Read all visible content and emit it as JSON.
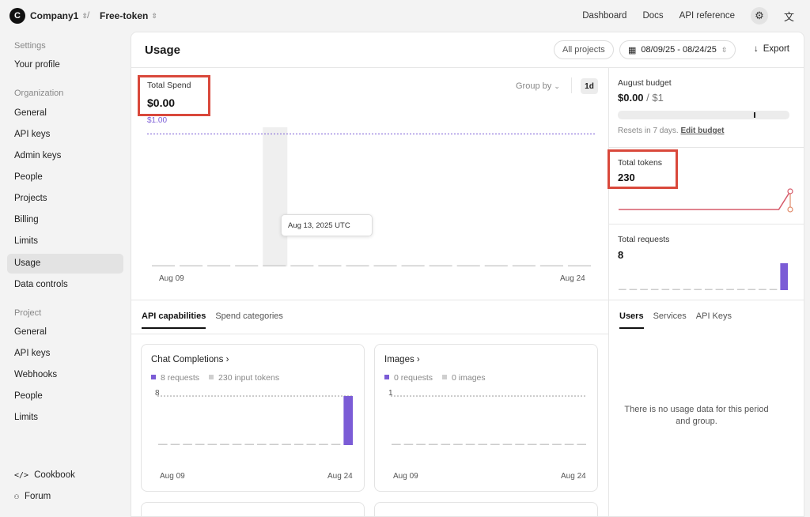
{
  "topbar": {
    "org_initial": "C",
    "org_name": "Company1",
    "project_name": "Free-token",
    "links": [
      "Dashboard",
      "Docs",
      "API reference"
    ],
    "gear_icon": "gear-icon",
    "translate_icon": "translate-icon"
  },
  "sidebar": {
    "settings_heading": "Settings",
    "your_profile": "Your profile",
    "organization_heading": "Organization",
    "org_items": [
      "General",
      "API keys",
      "Admin keys",
      "People",
      "Projects",
      "Billing",
      "Limits",
      "Usage",
      "Data controls"
    ],
    "active_item": "Usage",
    "project_heading": "Project",
    "project_items": [
      "General",
      "API keys",
      "Webhooks",
      "People",
      "Limits"
    ],
    "cookbook": "Cookbook",
    "forum": "Forum"
  },
  "header": {
    "title": "Usage",
    "projects_button": "All projects",
    "date_range": "08/09/25 - 08/24/25",
    "export_label": "Export"
  },
  "spend": {
    "label": "Total Spend",
    "value": "$0.00",
    "budget_line_label": "$1.00",
    "group_by": "Group by",
    "granularity": "1d",
    "tooltip": "Aug 13, 2025 UTC",
    "x_start": "Aug 09",
    "x_end": "Aug 24"
  },
  "budget": {
    "label": "August budget",
    "spent": "$0.00",
    "limit": "/ $1",
    "used_fraction": 0.0,
    "resets": "Resets in 7 days.",
    "edit_link": "Edit budget"
  },
  "tokens": {
    "label": "Total tokens",
    "value": "230"
  },
  "requests": {
    "label": "Total requests",
    "value": "8"
  },
  "capabilities": {
    "tabs": [
      "API capabilities",
      "Spend categories"
    ],
    "active_tab": "API capabilities",
    "chat": {
      "title": "Chat Completions",
      "legend_requests": "8 requests",
      "legend_tokens": "230 input tokens",
      "y_top": "8",
      "x_start": "Aug 09",
      "x_end": "Aug 24"
    },
    "images": {
      "title": "Images",
      "legend_requests": "0 requests",
      "legend_images": "0 images",
      "y_top": "1",
      "x_start": "Aug 09",
      "x_end": "Aug 24"
    }
  },
  "right_tabs": {
    "tabs": [
      "Users",
      "Services",
      "API Keys"
    ],
    "active_tab": "Users",
    "empty_message": "There is no usage data for this period and group."
  },
  "colors": {
    "accent": "#7b5cd6",
    "highlight": "#d9483b",
    "tokens_line": "#d65a6a"
  },
  "chart_data": [
    {
      "type": "bar",
      "title": "Total Spend",
      "categories": [
        "Aug 09",
        "Aug 10",
        "Aug 11",
        "Aug 12",
        "Aug 13",
        "Aug 14",
        "Aug 15",
        "Aug 16",
        "Aug 17",
        "Aug 18",
        "Aug 19",
        "Aug 20",
        "Aug 21",
        "Aug 22",
        "Aug 23",
        "Aug 24"
      ],
      "values": [
        0,
        0,
        0,
        0,
        0,
        0,
        0,
        0,
        0,
        0,
        0,
        0,
        0,
        0,
        0,
        0
      ],
      "budget_line": 1.0,
      "ylim": [
        0,
        1.05
      ],
      "hovered_category": "Aug 13"
    },
    {
      "type": "line",
      "title": "Total tokens",
      "categories": [
        "Aug 09",
        "Aug 10",
        "Aug 11",
        "Aug 12",
        "Aug 13",
        "Aug 14",
        "Aug 15",
        "Aug 16",
        "Aug 17",
        "Aug 18",
        "Aug 19",
        "Aug 20",
        "Aug 21",
        "Aug 22",
        "Aug 23",
        "Aug 24"
      ],
      "values": [
        0,
        0,
        0,
        0,
        0,
        0,
        0,
        0,
        0,
        0,
        0,
        0,
        0,
        0,
        0,
        230
      ],
      "ylim": [
        0,
        230
      ]
    },
    {
      "type": "bar",
      "title": "Total requests",
      "categories": [
        "Aug 09",
        "Aug 10",
        "Aug 11",
        "Aug 12",
        "Aug 13",
        "Aug 14",
        "Aug 15",
        "Aug 16",
        "Aug 17",
        "Aug 18",
        "Aug 19",
        "Aug 20",
        "Aug 21",
        "Aug 22",
        "Aug 23",
        "Aug 24"
      ],
      "values": [
        0,
        0,
        0,
        0,
        0,
        0,
        0,
        0,
        0,
        0,
        0,
        0,
        0,
        0,
        0,
        8
      ],
      "ylim": [
        0,
        8
      ]
    },
    {
      "type": "bar",
      "title": "Chat Completions",
      "categories": [
        "Aug 09",
        "Aug 10",
        "Aug 11",
        "Aug 12",
        "Aug 13",
        "Aug 14",
        "Aug 15",
        "Aug 16",
        "Aug 17",
        "Aug 18",
        "Aug 19",
        "Aug 20",
        "Aug 21",
        "Aug 22",
        "Aug 23",
        "Aug 24"
      ],
      "values": [
        0,
        0,
        0,
        0,
        0,
        0,
        0,
        0,
        0,
        0,
        0,
        0,
        0,
        0,
        0,
        8
      ],
      "ylim": [
        0,
        8
      ]
    },
    {
      "type": "bar",
      "title": "Images",
      "categories": [
        "Aug 09",
        "Aug 10",
        "Aug 11",
        "Aug 12",
        "Aug 13",
        "Aug 14",
        "Aug 15",
        "Aug 16",
        "Aug 17",
        "Aug 18",
        "Aug 19",
        "Aug 20",
        "Aug 21",
        "Aug 22",
        "Aug 23",
        "Aug 24"
      ],
      "values": [
        0,
        0,
        0,
        0,
        0,
        0,
        0,
        0,
        0,
        0,
        0,
        0,
        0,
        0,
        0,
        0
      ],
      "ylim": [
        0,
        1
      ]
    }
  ]
}
